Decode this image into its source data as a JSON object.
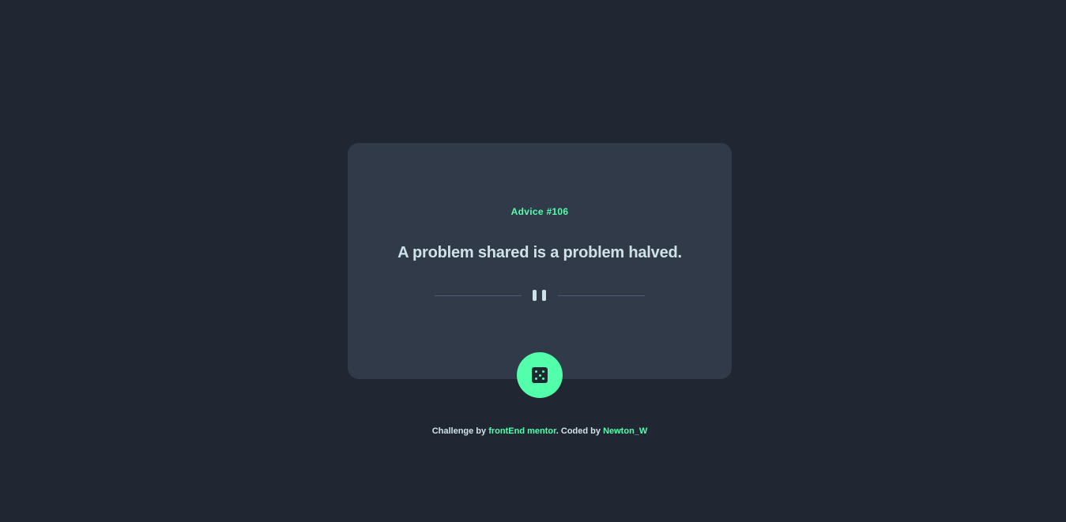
{
  "card": {
    "advice_label": "Advice #106",
    "quote": "A problem shared is a problem halved."
  },
  "divider": {
    "icon": "pause-quote-icon"
  },
  "dice_button": {
    "icon": "dice-icon"
  },
  "footer": {
    "prefix": "Challenge by ",
    "challenge_link": "frontEnd mentor",
    "middle": ". Coded by ",
    "author_link": "Newton_W"
  },
  "colors": {
    "background": "#202632",
    "card": "#313a48",
    "accent": "#53ffaa",
    "text": "#cee3e9",
    "divider": "#4f5d74"
  }
}
